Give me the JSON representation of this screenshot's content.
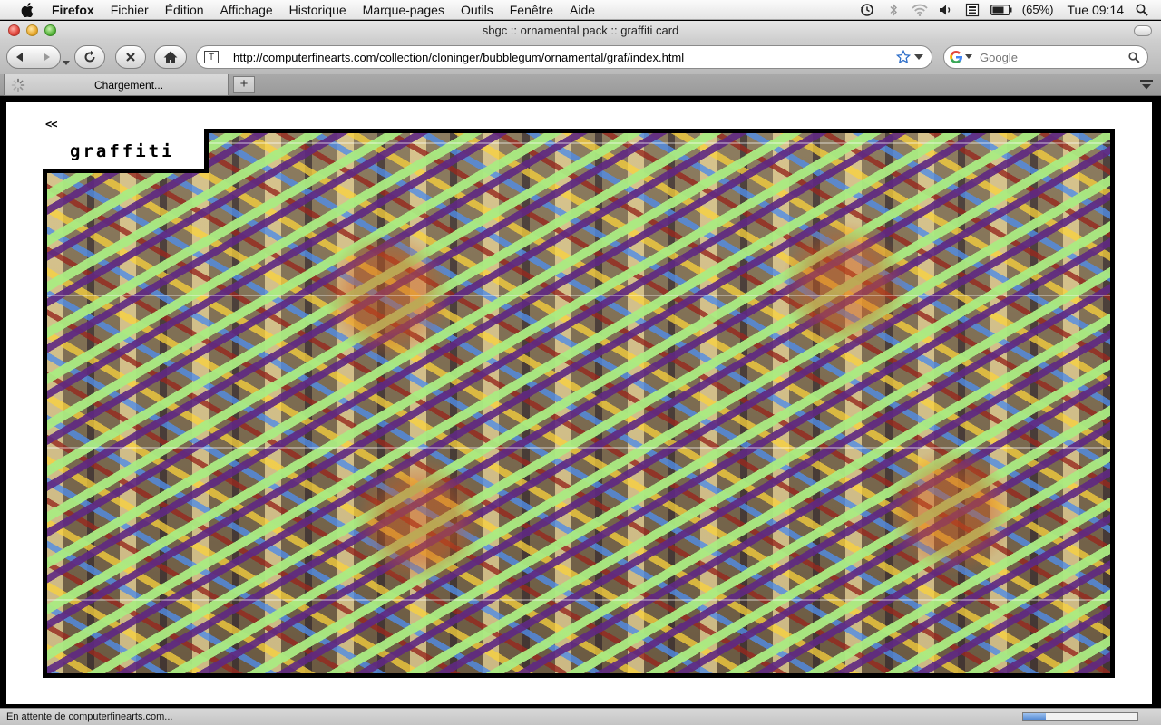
{
  "menubar": {
    "app": "Firefox",
    "items": [
      "Fichier",
      "Édition",
      "Affichage",
      "Historique",
      "Marque-pages",
      "Outils",
      "Fenêtre",
      "Aide"
    ],
    "battery": "(65%)",
    "clock": "Tue 09:14",
    "icons": [
      "apple-icon",
      "time-machine-icon",
      "bluetooth-icon",
      "wifi-icon",
      "volume-icon",
      "input-menu-icon",
      "battery-icon",
      "spotlight-icon"
    ]
  },
  "window": {
    "title": "sbgc :: ornamental pack :: graffiti card"
  },
  "toolbar": {
    "url": "http://computerfinearts.com/collection/cloninger/bubblegum/ornamental/graf/index.html",
    "search_placeholder": "Google"
  },
  "tabs": [
    {
      "label": "Chargement..."
    }
  ],
  "page": {
    "back_link": "<<",
    "title": "graffiti"
  },
  "status": {
    "text": "En attente de computerfinearts.com...",
    "progress": 0.2
  }
}
